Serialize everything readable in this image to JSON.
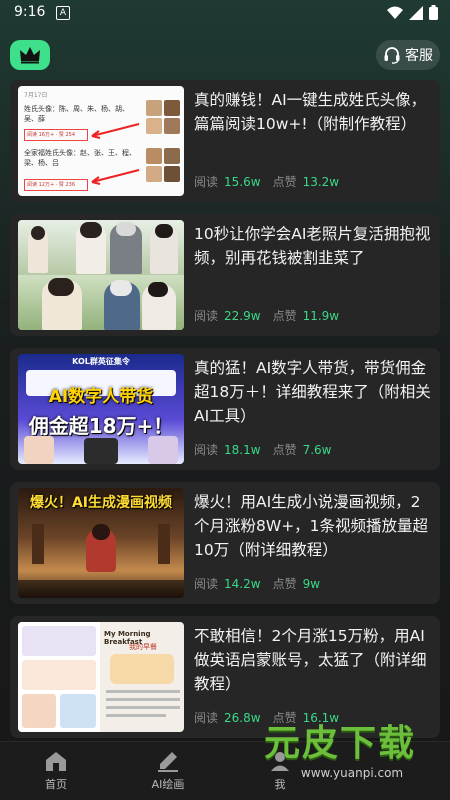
{
  "status": {
    "time": "9:16",
    "notif_badge": "A"
  },
  "header": {
    "service_label": "客服"
  },
  "cards": [
    {
      "title": "真的赚钱！AI一键生成姓氏头像，篇篇阅读10w+!（附制作教程）",
      "read_label": "阅读",
      "read": "15.6w",
      "like_label": "点赞",
      "like": "13.2w"
    },
    {
      "title": "10秒让你学会AI老照片复活拥抱视频，别再花钱被割韭菜了",
      "read_label": "阅读",
      "read": "22.9w",
      "like_label": "点赞",
      "like": "11.9w"
    },
    {
      "title": "真的猛！AI数字人带货，带货佣金超18万＋！详细教程来了（附相关AI工具）",
      "read_label": "阅读",
      "read": "18.1w",
      "like_label": "点赞",
      "like": "7.6w"
    },
    {
      "title": "爆火！用AI生成小说漫画视频，2个月涨粉8W+，1条视频播放量超10万（附详细教程）",
      "read_label": "阅读",
      "read": "14.2w",
      "like_label": "点赞",
      "like": "9w"
    },
    {
      "title": "不敢相信！2个月涨15万粉，用AI做英语启蒙账号，太猛了（附详细教程）",
      "read_label": "阅读",
      "read": "26.8w",
      "like_label": "点赞",
      "like": "16.1w"
    }
  ],
  "thumbs": {
    "t1": {
      "date": "7月17日",
      "row1": "姓氏头像：陈、周、朱、杨、胡、吴、薛",
      "row2": "全家福姓氏头像：赵、张、王、程、梁、杨、吕",
      "meta1": "阅读 16万+ · 赞 254",
      "meta2": "阅读 12万+ · 赞 236"
    },
    "t3": {
      "banner": "KOL群英征集令",
      "l1": "AI数字人带货",
      "l2": "佣金超18万+！"
    },
    "t4": {
      "headline": "爆火！AI生成漫画视频"
    },
    "t5": {
      "book": "My Morning Breakfast",
      "sub": "我的早餐"
    }
  },
  "tabs": [
    {
      "label": "首页"
    },
    {
      "label": "AI绘画"
    },
    {
      "label": "我"
    }
  ],
  "watermark": {
    "text": "元皮下载",
    "url": "www.yuanpi.com"
  },
  "colors": {
    "accent": "#39d987",
    "crown_bg": "#3ee08c",
    "card_bg": "#262626"
  }
}
